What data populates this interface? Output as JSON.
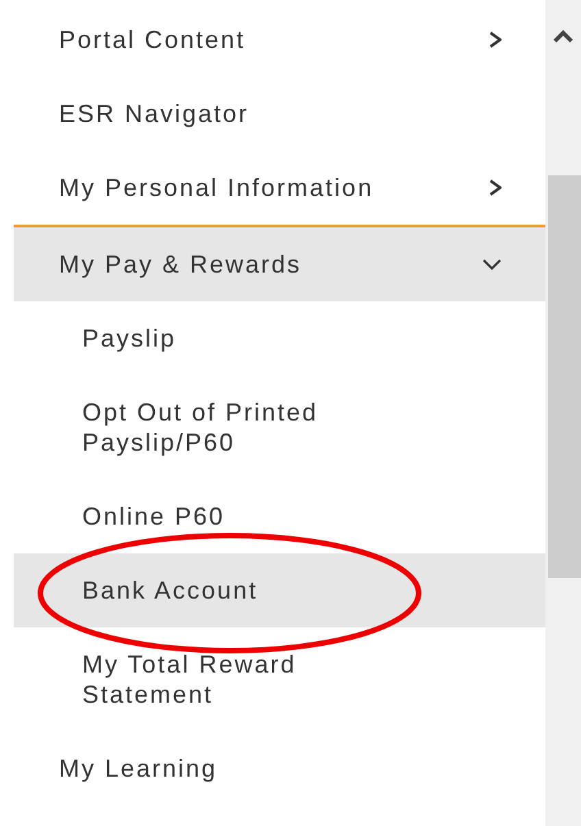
{
  "menu": {
    "items": [
      {
        "label": "Portal Content",
        "kind": "branch",
        "expanded": false,
        "selected": false,
        "circled": false
      },
      {
        "label": "ESR Navigator",
        "kind": "link",
        "selected": false,
        "circled": false
      },
      {
        "label": "My Personal Information",
        "kind": "branch",
        "expanded": false,
        "selected": false,
        "circled": false
      },
      {
        "label": "My Pay & Rewards",
        "kind": "branch",
        "expanded": true,
        "selected": true,
        "circled": false,
        "children": [
          {
            "label": "Payslip",
            "kind": "link",
            "selected": false,
            "circled": false
          },
          {
            "label": "Opt Out of Printed Payslip/P60",
            "kind": "link",
            "selected": false,
            "circled": false
          },
          {
            "label": "Online P60",
            "kind": "link",
            "selected": false,
            "circled": false
          },
          {
            "label": "Bank Account",
            "kind": "link",
            "selected": true,
            "circled": true
          },
          {
            "label": "My Total Reward Statement",
            "kind": "link",
            "selected": false,
            "circled": false
          }
        ]
      },
      {
        "label": "My Learning",
        "kind": "link",
        "selected": false,
        "circled": false
      }
    ]
  }
}
